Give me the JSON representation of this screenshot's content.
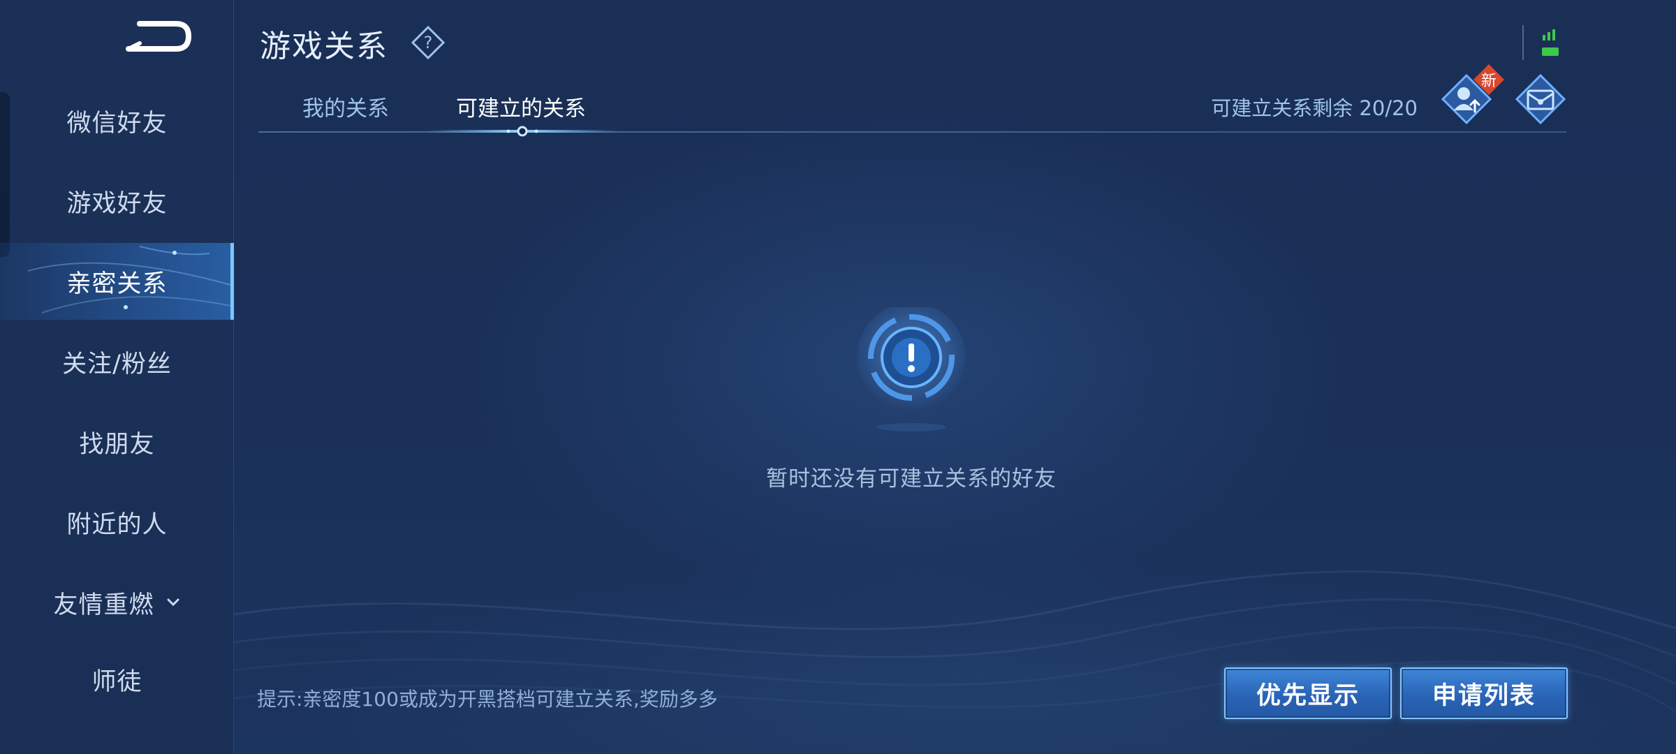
{
  "header": {
    "title": "游戏关系",
    "help_icon": "question-diamond-icon"
  },
  "sidebar": {
    "back_icon": "back-arrow-icon",
    "items": [
      {
        "label": "微信好友",
        "active": false
      },
      {
        "label": "游戏好友",
        "active": false
      },
      {
        "label": "亲密关系",
        "active": true
      },
      {
        "label": "关注/粉丝",
        "active": false
      },
      {
        "label": "找朋友",
        "active": false
      },
      {
        "label": "附近的人",
        "active": false
      },
      {
        "label": "友情重燃",
        "active": false,
        "icon": "chevron-down-icon"
      },
      {
        "label": "师徒",
        "active": false
      }
    ]
  },
  "tabs": [
    {
      "label": "我的关系",
      "active": false
    },
    {
      "label": "可建立的关系",
      "active": true
    }
  ],
  "quota": {
    "text": "可建立关系剩余 20/20"
  },
  "actions": {
    "upgrade_icon": "user-upgrade-icon",
    "new_badge": "新",
    "mailbox_icon": "mailbox-icon"
  },
  "empty_state": {
    "icon": "exclamation-circle-icon",
    "message": "暂时还没有可建立关系的好友"
  },
  "footer": {
    "hint": "提示:亲密度100或成为开黑搭档可建立关系,奖励多多",
    "priority_button": "优先显示",
    "request_list_button": "申请列表"
  },
  "colors": {
    "background": "#1a2f56",
    "accent": "#3f86d8",
    "badge": "#d9472f",
    "signal": "#3ec94a"
  }
}
